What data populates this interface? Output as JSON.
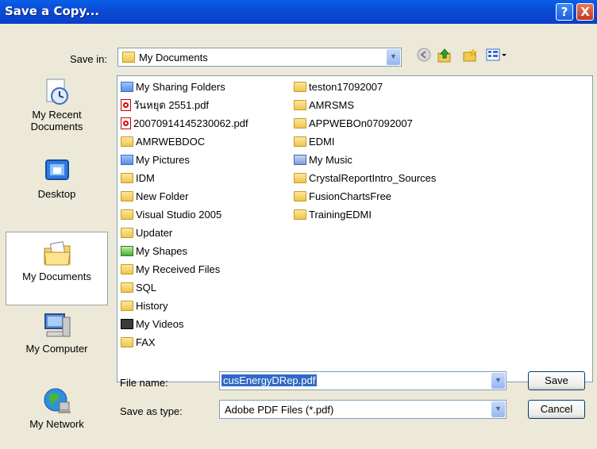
{
  "window": {
    "title": "Save a Copy...",
    "help_label": "?",
    "close_label": "X"
  },
  "save_in": {
    "label": "Save in:",
    "value": "My Documents"
  },
  "toolbar_icons": [
    "back-icon",
    "up-folder-icon",
    "new-folder-icon",
    "views-menu-icon"
  ],
  "places": [
    {
      "label": "My Recent\nDocuments",
      "icon": "recent-documents-icon"
    },
    {
      "label": "Desktop",
      "icon": "desktop-icon"
    },
    {
      "label": "My Documents",
      "icon": "my-documents-icon"
    },
    {
      "label": "My Computer",
      "icon": "my-computer-icon"
    },
    {
      "label": "My Network",
      "icon": "my-network-icon"
    }
  ],
  "files_col1": [
    {
      "name": "My Sharing Folders",
      "icon": "special"
    },
    {
      "name": "วันหยุด 2551.pdf",
      "icon": "pdf"
    },
    {
      "name": "20070914145230062.pdf",
      "icon": "pdf"
    },
    {
      "name": "AMRWEBDOC",
      "icon": "folder"
    },
    {
      "name": "My Pictures",
      "icon": "special"
    },
    {
      "name": "IDM",
      "icon": "folder"
    },
    {
      "name": "New Folder",
      "icon": "folder"
    },
    {
      "name": "Visual Studio 2005",
      "icon": "folder"
    },
    {
      "name": "Updater",
      "icon": "folder"
    },
    {
      "name": "My Shapes",
      "icon": "green"
    },
    {
      "name": "My Received Files",
      "icon": "folder"
    },
    {
      "name": "SQL",
      "icon": "folder"
    },
    {
      "name": "History",
      "icon": "folder"
    },
    {
      "name": "My Videos",
      "icon": "video"
    },
    {
      "name": "FAX",
      "icon": "folder"
    }
  ],
  "files_col2": [
    {
      "name": "teston17092007",
      "icon": "folder"
    },
    {
      "name": "AMRSMS",
      "icon": "folder"
    },
    {
      "name": "APPWEBOn07092007",
      "icon": "folder"
    },
    {
      "name": "EDMI",
      "icon": "folder"
    },
    {
      "name": "My Music",
      "icon": "music"
    },
    {
      "name": "CrystalReportIntro_Sources",
      "icon": "folder"
    },
    {
      "name": "FusionChartsFree",
      "icon": "folder"
    },
    {
      "name": "TrainingEDMI",
      "icon": "folder"
    }
  ],
  "file_name": {
    "label": "File name:",
    "value": "cusEnergyDRep.pdf"
  },
  "save_as_type": {
    "label": "Save as type:",
    "value": "Adobe PDF Files (*.pdf)"
  },
  "buttons": {
    "save": "Save",
    "cancel": "Cancel"
  }
}
